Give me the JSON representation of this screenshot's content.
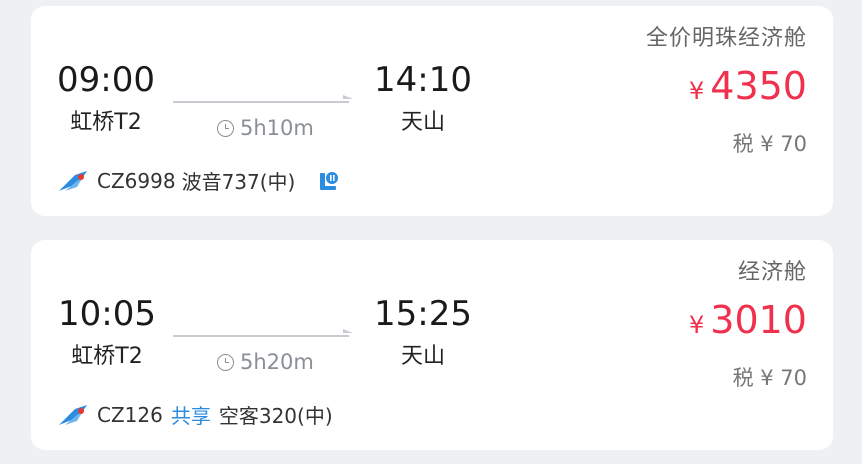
{
  "flights": [
    {
      "cabin": "全价明珠经济舱",
      "departure": {
        "time": "09:00",
        "airport": "虹桥T2"
      },
      "arrival": {
        "time": "14:10",
        "airport": "天山"
      },
      "duration": "5h10m",
      "price": {
        "currency": "¥",
        "amount": "4350"
      },
      "tax": "税 ¥ 70",
      "flight_no": "CZ6998",
      "shared": "",
      "aircraft": "波音737(中)",
      "icons": [
        "airline-logo-icon",
        "clock-icon",
        "meal-service-icon"
      ]
    },
    {
      "cabin": "经济舱",
      "departure": {
        "time": "10:05",
        "airport": "虹桥T2"
      },
      "arrival": {
        "time": "15:25",
        "airport": "天山"
      },
      "duration": "5h20m",
      "price": {
        "currency": "¥",
        "amount": "3010"
      },
      "tax": "税 ¥ 70",
      "flight_no": "CZ126",
      "shared": "共享",
      "aircraft": "空客320(中)",
      "icons": [
        "airline-logo-icon",
        "clock-icon"
      ]
    }
  ],
  "colors": {
    "price": "#f0314e",
    "shared_tag": "#2b8ce0",
    "airline_logo": "#2b8ce0",
    "airline_logo_accent": "#e8382d",
    "background": "#eef1f4"
  }
}
